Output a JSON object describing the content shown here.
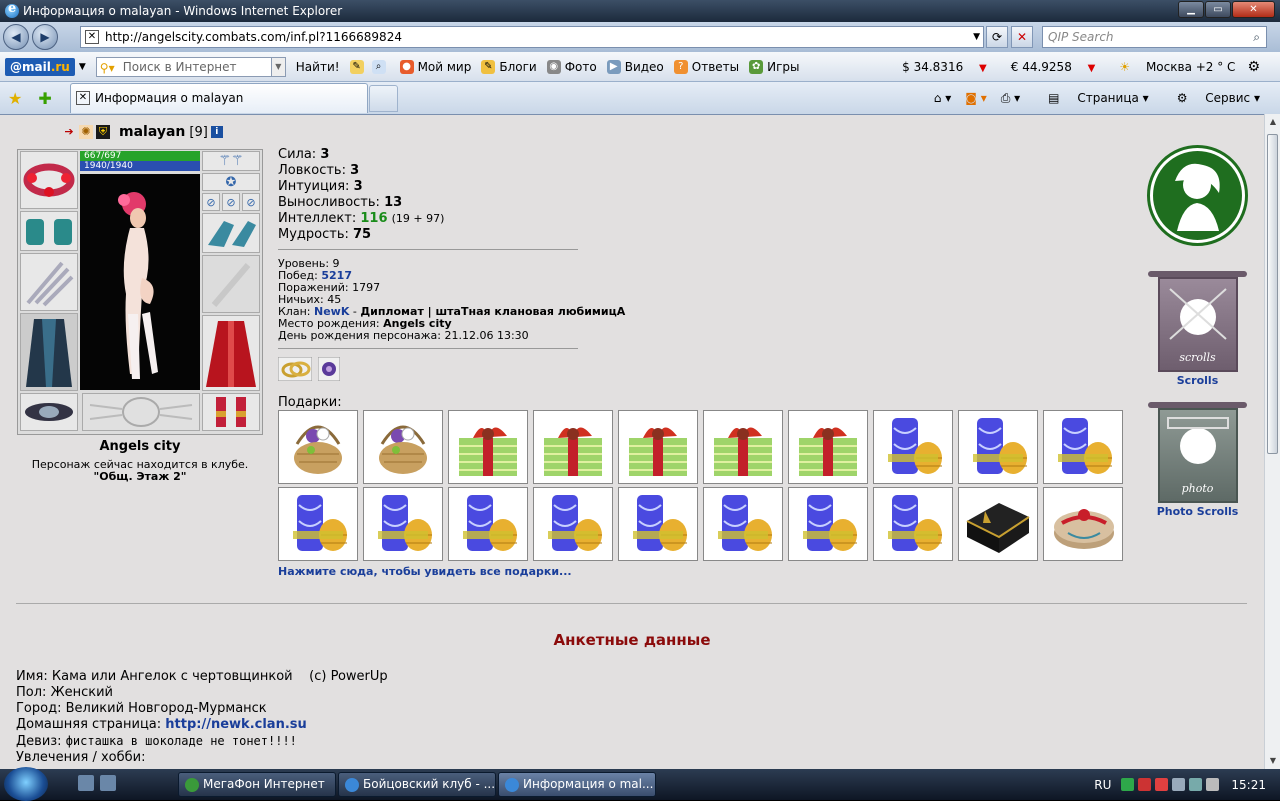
{
  "window": {
    "title": "Информация о malayan - Windows Internet Explorer"
  },
  "address": {
    "url": "http://angelscity.combats.com/inf.pl?1166689824",
    "search_placeholder": "QIP Search"
  },
  "toolbar": {
    "logo_mail": "@mail",
    "logo_ru": ".ru",
    "search_placeholder": "Поиск в Интернет",
    "search_button": "Найти!",
    "items": [
      "Мой мир",
      "Блоги",
      "Фото",
      "Видео",
      "Ответы",
      "Игры"
    ],
    "usd": "$ 34.8316",
    "eur": "€ 44.9258",
    "weather": "Москва +2 ° C"
  },
  "tab": {
    "title": "Информация о malayan"
  },
  "commands": {
    "page": "Страница",
    "service": "Сервис"
  },
  "character": {
    "name": "malayan",
    "level": "[9]",
    "hp": "667/697",
    "mana": "1940/1940",
    "city": "Angels city",
    "location_line": "Персонаж сейчас находится в клубе.",
    "location_room": "\"Общ. Этаж 2\""
  },
  "stats": {
    "str_label": "Сила:",
    "str": "3",
    "agi_label": "Ловкость:",
    "agi": "3",
    "int_label": "Интуиция:",
    "int": "3",
    "end_label": "Выносливость:",
    "end": "13",
    "intel_label": "Интеллект:",
    "intel": "116",
    "intel_extra": "(19 + 97)",
    "wis_label": "Мудрость:",
    "wis": "75"
  },
  "info": {
    "level_label": "Уровень:",
    "level": "9",
    "wins_label": "Побед:",
    "wins": "5217",
    "losses_label": "Поражений:",
    "losses": "1797",
    "draws_label": "Ничьих:",
    "draws": "45",
    "clan_label": "Клан:",
    "clan": "NewK",
    "clan_role": "Дипломат | штаТная клановая любимицА",
    "birthplace_label": "Место рождения:",
    "birthplace": "Angels city",
    "birthday_label": "День рождения персонажа:",
    "birthday": "21.12.06 13:30"
  },
  "gifts": {
    "label": "Подарки:",
    "more": "Нажмите сюда, чтобы увидеть все подарки...",
    "items": [
      "basket",
      "basket",
      "box",
      "box",
      "box",
      "box",
      "box",
      "vase",
      "vase",
      "vase",
      "vase",
      "vase",
      "vase",
      "vase",
      "vase",
      "vase",
      "vase",
      "vase",
      "chest",
      "cake"
    ]
  },
  "anketa": {
    "title": "Анкетные данные",
    "name_label": "Имя:",
    "name": "Кама или Ангелок с чертовщинкой    (c) PowerUp",
    "sex_label": "Пол:",
    "sex": "Женский",
    "city_label": "Город:",
    "city": "Великий Новгород-Мурманск",
    "home_label": "Домашняя страница:",
    "home": "http://newk.clan.su",
    "motto_label": "Девиз:",
    "motto": "фисташка в шоколаде не тонет!!!!",
    "hobby_label": "Увлечения / хобби:"
  },
  "sidebar": {
    "scrolls": "Scrolls",
    "photo_scrolls": "Photo Scrolls",
    "scrolls_flag": "scrolls",
    "photo_flag": "photo"
  },
  "taskbar": {
    "buttons": [
      "МегаФон Интернет",
      "Бойцовский клуб - ...",
      "Информация о mal..."
    ],
    "lang": "RU",
    "time": "15:21"
  },
  "colors": {
    "accent_blue": "#1a3e9a",
    "anketa_red": "#8b0b0b",
    "green": "#1a8c1a"
  }
}
